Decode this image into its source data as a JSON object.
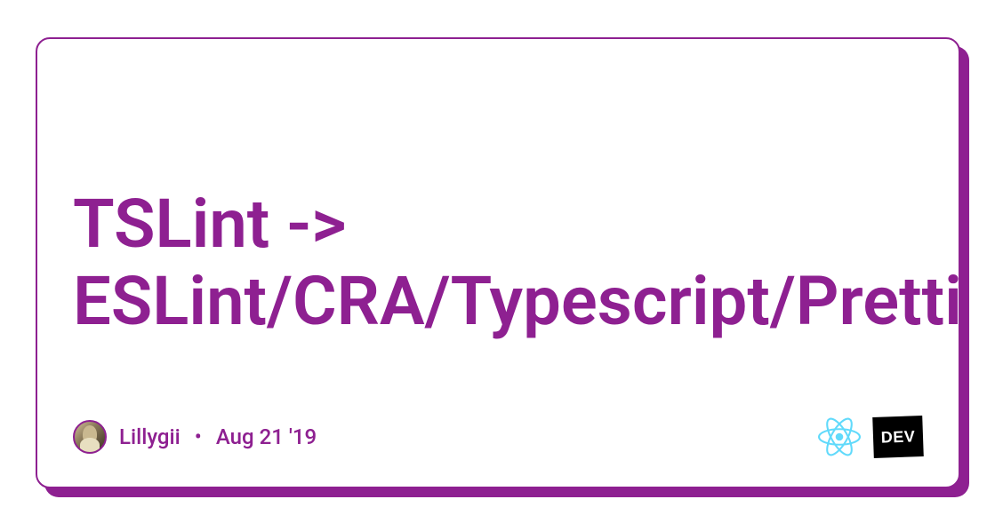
{
  "card": {
    "title": "TSLint -> ESLint/CRA/Typescript/Prettier",
    "author": "Lillygii",
    "date": "Aug 21 '19"
  },
  "logos": {
    "react_name": "react-icon",
    "dev_label": "DEV"
  },
  "colors": {
    "accent": "#8e2091",
    "react_blue": "#61dafb"
  }
}
